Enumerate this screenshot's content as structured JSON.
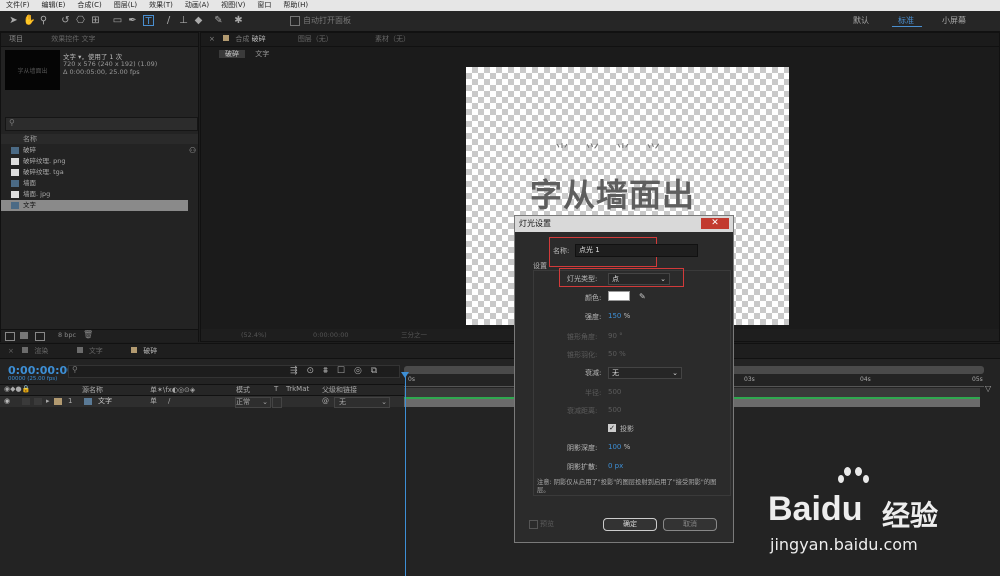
{
  "menu": [
    "文件(F)",
    "编辑(E)",
    "合成(C)",
    "图层(L)",
    "效果(T)",
    "动画(A)",
    "视图(V)",
    "窗口",
    "帮助(H)"
  ],
  "toolbar": {
    "auto_open_label": "自动打开面板",
    "workspaces": [
      "默认",
      "标准",
      "小屏幕"
    ],
    "active_workspace": "标准"
  },
  "project": {
    "tab_project": "项目",
    "tab_effects": "效果控件 文字",
    "info_name": "文字 ▾，使用了 1 次",
    "info_size": "720 x 576  (240 x 192) (1.09)",
    "info_duration": "Δ 0:00:05:00, 25.00 fps",
    "col_name": "名称",
    "items": [
      "破碎",
      "破碎纹理. png",
      "破碎纹理. tga",
      "墙面",
      "墙面. jpg",
      "文字"
    ],
    "bpc": "8 bpc"
  },
  "viewer": {
    "tab_comp_prefix": "合成",
    "tab_comp": "破碎",
    "tab_layer": "图层（无）",
    "tab_footage": "素材（无）",
    "crumb1": "破碎",
    "crumb2": "文字",
    "canvas_text": "字从墙面出",
    "zoom": "(52.4%)",
    "timecode": "0:00:00:00",
    "quality": "三分之一"
  },
  "timeline": {
    "tab_render": "渲染",
    "tab_text": "文字",
    "tab_comp": "破碎",
    "timecode": "0:00:00:00",
    "frames": "00000 (25.00 fps)",
    "col_source": "源名称",
    "col_mode": "模式",
    "col_t": "T",
    "col_trkmat": "TrkMat",
    "col_parent": "父级和链接",
    "layer_index": "1",
    "layer_name": "文字",
    "layer_mode": "正常",
    "layer_parent": "无",
    "ticks": [
      "0s",
      "03s",
      "04s",
      "05s"
    ]
  },
  "dialog": {
    "title": "灯光设置",
    "name_label": "名称:",
    "name_value": "点光 1",
    "section": "设置",
    "type_label": "灯光类型:",
    "type_value": "点",
    "color_label": "颜色:",
    "color_value": "#ffffff",
    "intensity_label": "强度:",
    "intensity_value": "150",
    "intensity_unit": "%",
    "cone_angle_label": "锥形角度:",
    "cone_angle_value": "90 °",
    "cone_feather_label": "锥形羽化:",
    "cone_feather_value": "50 %",
    "falloff_label": "衰减:",
    "falloff_value": "无",
    "radius_label": "半径:",
    "radius_value": "500",
    "falloff_dist_label": "衰减距离:",
    "falloff_dist_value": "500",
    "shadow_label": "投影",
    "shadow_depth_label": "阴影深度:",
    "shadow_depth_value": "100",
    "shadow_depth_unit": "%",
    "shadow_diffuse_label": "阴影扩散:",
    "shadow_diffuse_value": "0 px",
    "note": "注意: 阴影仅从启用了\"投影\"的图层投射到启用了\"接受阴影\"的图层。",
    "preview_label": "预览",
    "ok_label": "确定",
    "cancel_label": "取消"
  },
  "watermark": {
    "brand": "Bai",
    "brand2": "du",
    "cn": "经验",
    "url": "jingyan.baidu.com"
  }
}
